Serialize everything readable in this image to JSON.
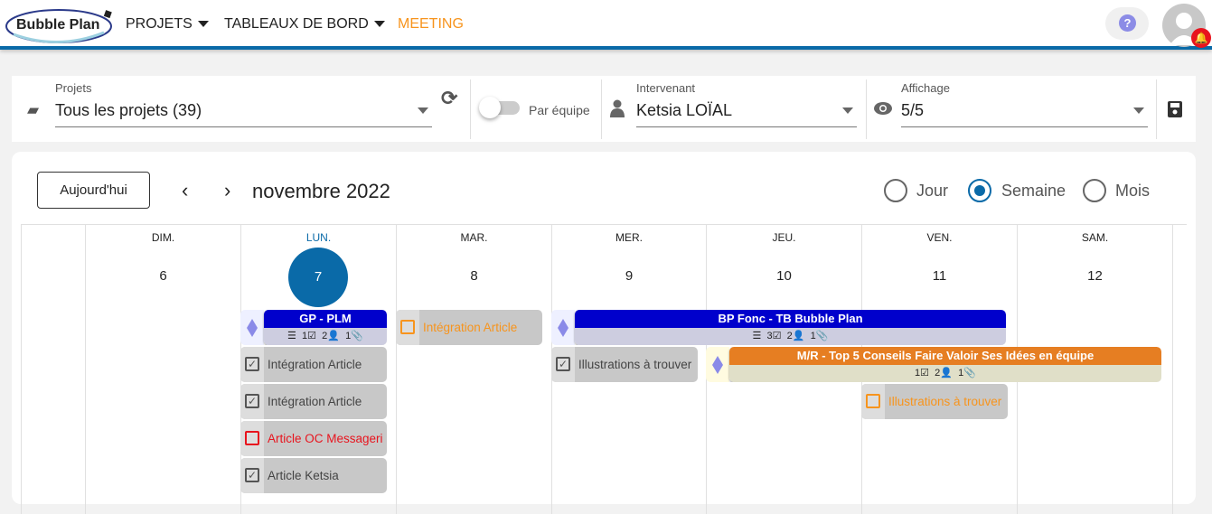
{
  "header": {
    "logo": "Bubble Plan",
    "nav": [
      {
        "label": "PROJETS"
      },
      {
        "label": "TABLEAUX DE BORD"
      },
      {
        "label": "MEETING"
      }
    ],
    "help": "?",
    "accent": "#0a6aa8",
    "meeting_color": "#f7941d"
  },
  "filters": {
    "projets": {
      "label": "Projets",
      "value": "Tous les projets (39)"
    },
    "team_toggle": {
      "label": "Par équipe",
      "on": false
    },
    "intervenant": {
      "label": "Intervenant",
      "value": "Ketsia LOÏAL"
    },
    "affichage": {
      "label": "Affichage",
      "value": "5/5"
    }
  },
  "calendar": {
    "today_button": "Aujourd'hui",
    "prev": "‹",
    "next": "›",
    "month": "novembre 2022",
    "views": [
      {
        "label": "Jour",
        "selected": false
      },
      {
        "label": "Semaine",
        "selected": true
      },
      {
        "label": "Mois",
        "selected": false
      }
    ],
    "days": [
      {
        "name": "DIM.",
        "num": "6"
      },
      {
        "name": "LUN.",
        "num": "7",
        "today": true
      },
      {
        "name": "MAR.",
        "num": "8"
      },
      {
        "name": "MER.",
        "num": "9"
      },
      {
        "name": "JEU.",
        "num": "10"
      },
      {
        "name": "VEN.",
        "num": "11"
      },
      {
        "name": "SAM.",
        "num": "12"
      }
    ],
    "projects": [
      {
        "title": "GP - PLM",
        "tasks": "1",
        "people": "2",
        "attachments": "1",
        "color": "#0000cc"
      },
      {
        "title": "BP Fonc - TB Bubble Plan",
        "tasks": "3",
        "people": "2",
        "attachments": "1",
        "color": "#0000cc"
      },
      {
        "title": "M/R - Top 5 Conseils Faire Valoir Ses Idées en équipe",
        "tasks": "1",
        "people": "2",
        "attachments": "1",
        "color": "#e67e22"
      }
    ],
    "tasks": [
      {
        "title": "Intégration Article",
        "status": "done"
      },
      {
        "title": "Intégration Article",
        "status": "done"
      },
      {
        "title": "Article OC Messageri",
        "status": "late"
      },
      {
        "title": "Article Ketsia",
        "status": "done"
      },
      {
        "title": "Intégration Article",
        "status": "todo"
      },
      {
        "title": "Illustrations à trouver",
        "status": "done"
      },
      {
        "title": "Illustrations à trouver",
        "status": "todo"
      }
    ]
  }
}
